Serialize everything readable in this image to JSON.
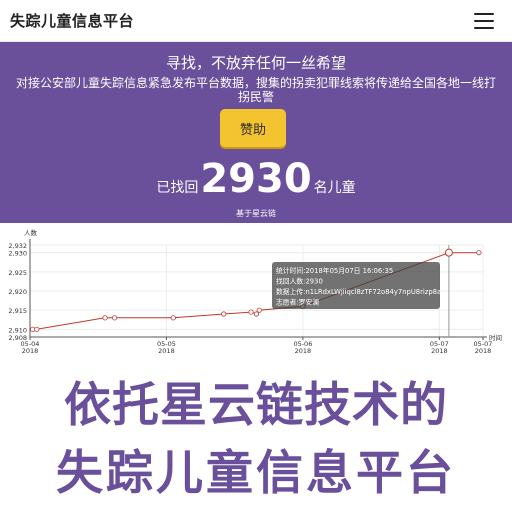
{
  "navbar": {
    "brand": "失踪儿童信息平台",
    "menu_icon": "hamburger-icon"
  },
  "hero": {
    "title": "寻找，不放弃任何一丝希望",
    "description": "对接公安部儿童失踪信息紧急发布平台数据，搜集的拐卖犯罪线索将传递给全国各地一线打拐民警",
    "donate_label": "赞助",
    "found_prefix": "已找回",
    "found_count": "2930",
    "found_suffix": "名儿童",
    "subtext": "基于星云链"
  },
  "colors": {
    "hero_bg": "#6a4f9b",
    "button": "#f3c42f",
    "series_line": "#c0392b",
    "banner_text": "#6a4f9b"
  },
  "chart_data": {
    "type": "line",
    "ylabel": "人数",
    "xlabel": "时间",
    "ylim": [
      2908,
      2932
    ],
    "yticks": [
      "2,908",
      "2,910",
      "2,915",
      "2,920",
      "2,925",
      "2,930",
      "2,932"
    ],
    "yticks_values": [
      2908,
      2910,
      2915,
      2920,
      2925,
      2930,
      2932
    ],
    "x_range": [
      "2018-05-04",
      "2018-05-07"
    ],
    "xticks": [
      {
        "label": "05-04\n2018",
        "t": 0
      },
      {
        "label": "05-05\n2018",
        "t": 1
      },
      {
        "label": "05-06\n2018",
        "t": 2
      },
      {
        "label": "05-07\n2018",
        "t": 3
      },
      {
        "label": "05-07\n2018",
        "t": 3.32
      }
    ],
    "x_t_range": [
      0,
      3.32
    ],
    "grid": true,
    "series": [
      {
        "points": [
          {
            "t": 0.02,
            "y": 2910
          },
          {
            "t": 0.05,
            "y": 2910
          },
          {
            "t": 0.55,
            "y": 2913
          },
          {
            "t": 0.62,
            "y": 2913
          },
          {
            "t": 1.05,
            "y": 2913
          },
          {
            "t": 1.42,
            "y": 2914
          },
          {
            "t": 1.62,
            "y": 2914.5
          },
          {
            "t": 1.66,
            "y": 2914
          },
          {
            "t": 1.68,
            "y": 2915
          },
          {
            "t": 2.0,
            "y": 2916
          },
          {
            "t": 3.07,
            "y": 2930
          },
          {
            "t": 3.29,
            "y": 2930
          }
        ]
      }
    ],
    "tooltip": {
      "lines": [
        "统计时间:2018年05月07日 16:06:35",
        "找回人数:2930",
        "数据上传:n1LRdxLWjiiqcl8zTF72o84y7npU8rizp8a",
        "志愿者:罗安澜"
      ]
    }
  },
  "banner": {
    "line1": "依托星云链技术的",
    "line2": "失踪儿童信息平台"
  }
}
